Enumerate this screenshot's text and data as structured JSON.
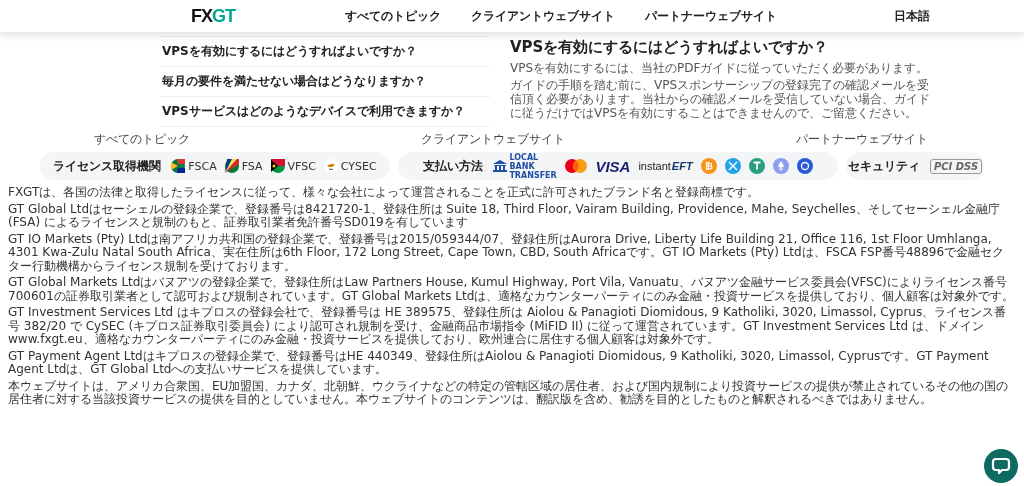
{
  "header": {
    "logo": [
      "FX",
      "GT"
    ],
    "nav": [
      "すべてのトピック",
      "クライアントウェブサイト",
      "パートナーウェブサイト"
    ],
    "language": "日本語"
  },
  "faq": {
    "questions": [
      "VPSを有効にするにはどうすればよいですか？",
      "毎月の要件を満たせない場合はどうなりますか？",
      "VPSサービスはどのようなデバイスで利用できますか？"
    ],
    "answer": {
      "title": "VPSを有効にするにはどうすればよいですか？",
      "paragraphs": [
        "VPSを有効にするには、当社のPDFガイドに従っていただく必要があります。",
        "ガイドの手順を踏む前に、VPSスポンサーシップの登録完了の確認メールを受信頂く必要があります。当社からの確認メールを受信していない場合、ガイドに従うだけではVPSを有効にすることはできませんので、ご留意ください。"
      ]
    }
  },
  "footer_nav": [
    "すべてのトピック",
    "クライアントウェブサイト",
    "パートナーウェブサイト"
  ],
  "badges": {
    "licenses": {
      "label": "ライセンス取得機関",
      "items": [
        {
          "name": "FSCA",
          "kind": "za"
        },
        {
          "name": "FSA",
          "kind": "sc"
        },
        {
          "name": "VFSC",
          "kind": "vu"
        },
        {
          "name": "CYSEC",
          "kind": "cy"
        }
      ]
    },
    "payments": {
      "label": "支払い方法",
      "items": [
        {
          "kind": "bank",
          "text": "LOCAL BANK TRANSFER"
        },
        {
          "kind": "mastercard"
        },
        {
          "kind": "visa",
          "text": "VISA"
        },
        {
          "kind": "eft",
          "text": "instant",
          "text2": "EFT"
        },
        {
          "kind": "bitcoin",
          "color": "#f7931a"
        },
        {
          "kind": "ripple",
          "color": "#23a2e8"
        },
        {
          "kind": "tether",
          "color": "#26a17b"
        },
        {
          "kind": "ethereum",
          "color": "#8c9ef0"
        },
        {
          "kind": "usdcoin",
          "color": "#2a5ada"
        }
      ]
    },
    "security": {
      "label": "セキュリティ",
      "logo": "PCI DSS"
    }
  },
  "disclaimers": [
    "FXGTは、各国の法律と取得したライセンスに従って、様々な会社によって運営されることを正式に許可されたブランド名と登録商標です。",
    "GT Global Ltdはセーシェルの登録企業で、登録番号は8421720-1、登録住所は Suite 18, Third Floor, Vairam Building, Providence, Mahe, Seychelles、そしてセーシェル金融庁 (FSA) によるライセンスと規制のもと、証券取引業者免許番号SD019を有しています",
    "GT IO Markets (Pty) Ltdは南アフリカ共和国の登録企業で、登録番号は2015/059344/07、登録住所はAurora Drive, Liberty Life Building 21, Office 116, 1st Floor Umhlanga, 4301 Kwa-Zulu Natal South Africa、実在住所は6th Floor, 172 Long Street, Cape Town, CBD, South Africaです。GT IO Markets (Pty) Ltdは、FSCA FSP番号48896で金融セクター行動機構からライセンス規制を受けております。",
    "GT Global Markets Ltdはバヌアツの登録企業で、登録住所はLaw Partners House, Kumul Highway, Port Vila, Vanuatu、バヌアツ金融サービス委員会(VFSC)によりライセンス番号700601の証券取引業者として認可および規制されています。GT Global Markets Ltdは、適格なカウンターパーティにのみ金融・投資サービスを提供しており、個人顧客は対象外です。",
    "GT Investment Services Ltd はキプロスの登録会社で、登録番号は HE 389575、登録住所は Aiolou & Panagioti Diomidous, 9 Katholiki, 3020, Limassol, Cyprus、ライセンス番号 382/20 で CySEC (キプロス証券取引委員会) により認可され規制を受け、金融商品市場指令 (MiFID II) に従って運営されています。GT Investment Services Ltd は、ドメインwww.fxgt.eu、適格なカウンターパーティにのみ金融・投資サービスを提供しており、欧州連合に居住する個人顧客は対象外です。",
    "GT Payment Agent Ltdはキプロスの登録企業で、登録番号はHE 440349、登録住所はAiolou & Panagioti Diomidous, 9 Katholiki, 3020, Limassol, Cyprusです。GT Payment Agent Ltdは、GT Global Ltdへの支払いサービスを提供しています。",
    "本ウェブサイトは、アメリカ合衆国、EU加盟国、カナダ、北朝鮮、ウクライナなどの特定の管轄区域の居住者、および国内規制により投資サービスの提供が禁止されているその他の国の居住者に対する当該投資サービスの提供を目的としていません。本ウェブサイトのコンテンツは、翻訳版を含め、勧誘を目的としたものと解釈されるべきではありません。"
  ]
}
